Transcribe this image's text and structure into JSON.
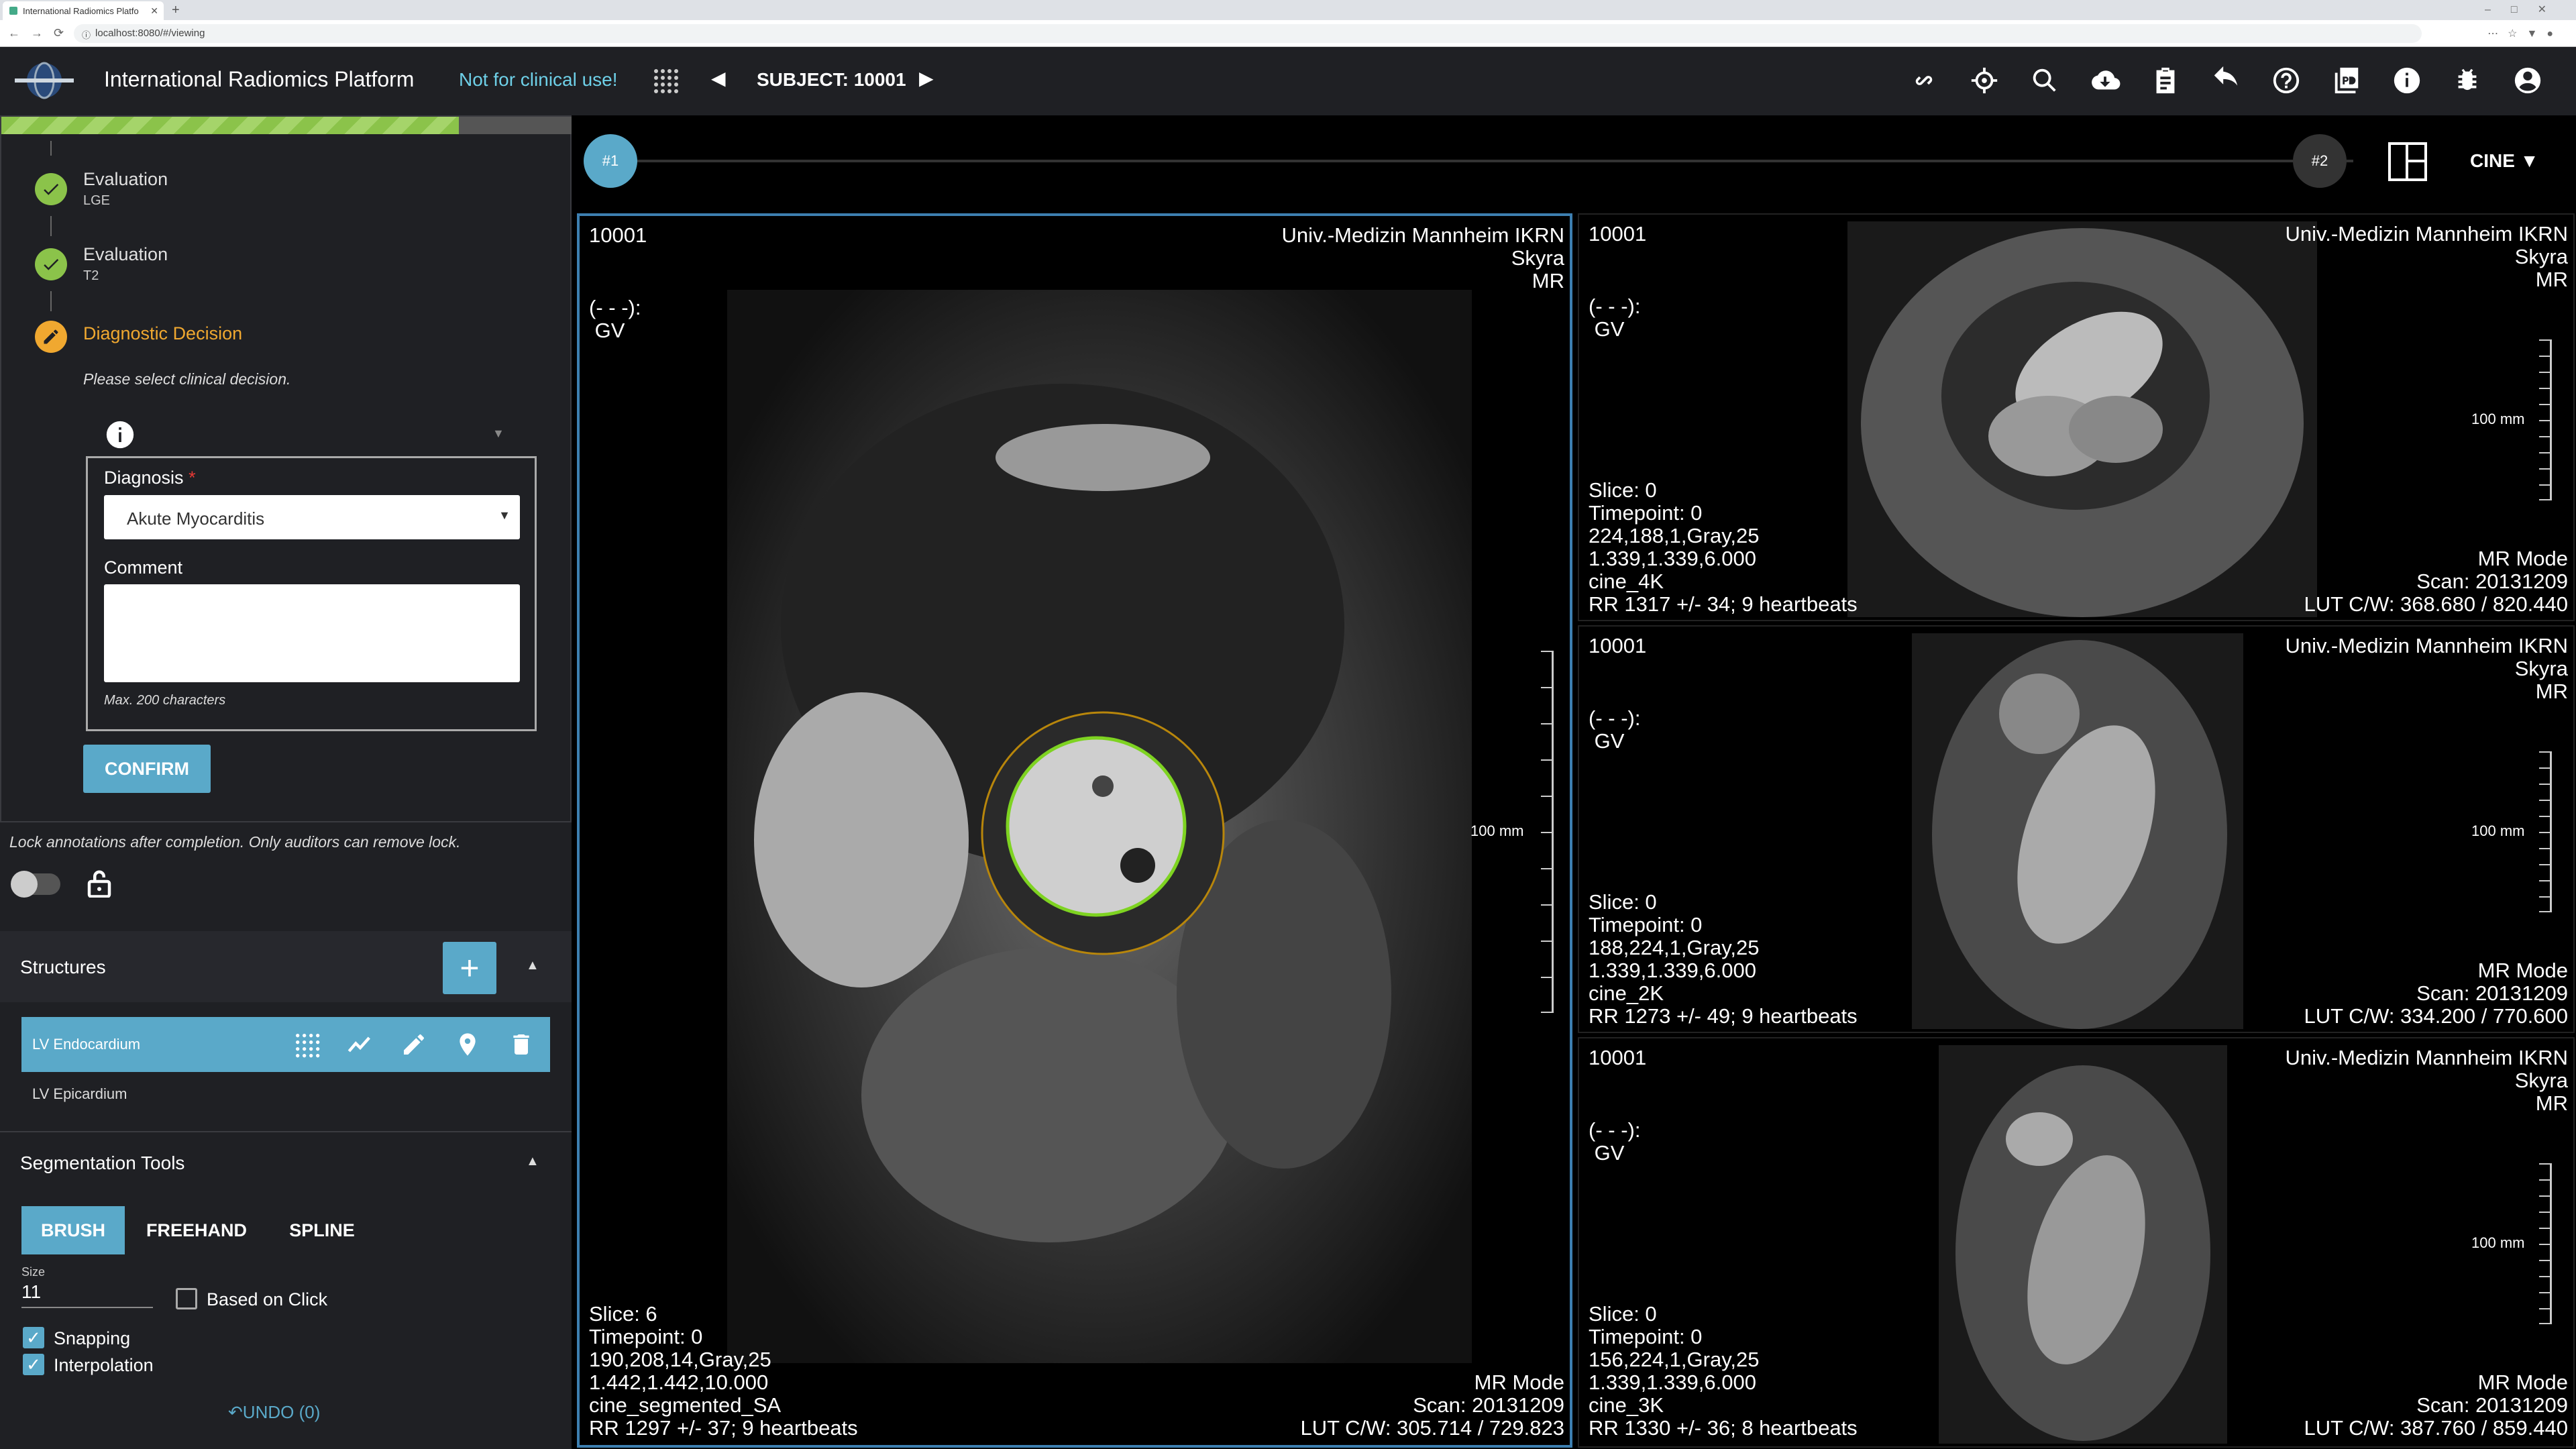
{
  "browser": {
    "tab_title": "International Radiomics Platfo",
    "url": "localhost:8080/#/viewing"
  },
  "header": {
    "title": "International Radiomics Platform",
    "warning": "Not for clinical use!",
    "subject": "SUBJECT: 10001",
    "icons": [
      "link-icon",
      "crosshair-icon",
      "zoom-icon",
      "cloud-download-icon",
      "clipboard-icon",
      "undo-icon",
      "help-icon",
      "pdf-icon",
      "info-icon",
      "bug-icon",
      "account-icon"
    ]
  },
  "workflow": {
    "progress_percent": 80,
    "steps": [
      {
        "title": "Evaluation",
        "sub": "LGE",
        "status": "done"
      },
      {
        "title": "Evaluation",
        "sub": "T2",
        "status": "done"
      },
      {
        "title": "Diagnostic Decision",
        "sub": "",
        "status": "active"
      }
    ],
    "instruction": "Please select clinical decision.",
    "diagnosis_label": "Diagnosis",
    "required_mark": "*",
    "diagnosis_value": "Akute Myocarditis",
    "comment_label": "Comment",
    "comment_value": "",
    "max_chars": "Max. 200 characters",
    "confirm_label": "CONFIRM",
    "lock_note": "Lock annotations after completion. Only auditors can remove lock."
  },
  "structures": {
    "title": "Structures",
    "add_label": "+",
    "items": [
      {
        "name": "LV Endocardium",
        "active": true
      },
      {
        "name": "LV Epicardium",
        "active": false
      }
    ]
  },
  "segmentation": {
    "title": "Segmentation Tools",
    "tabs": [
      "BRUSH",
      "FREEHAND",
      "SPLINE"
    ],
    "active_tab": "BRUSH",
    "size_label": "Size",
    "size_value": "11",
    "based_on_click": "Based on Click",
    "snapping": "Snapping",
    "interpolation": "Interpolation",
    "undo": "UNDO (0)"
  },
  "viewer": {
    "timeline_start": "#1",
    "timeline_end": "#2",
    "series": "CINE",
    "viewports": [
      {
        "id": "10001",
        "institution": "Univ.-Medizin Mannheim IKRN\nSkyra\nMR",
        "window": "(- - -):\n GV",
        "info": "Slice: 6\nTimepoint: 0\n190,208,14,Gray,25\n1.442,1.442,10.000\ncine_segmented_SA\nRR 1297 +/- 37; 9 heartbeats",
        "mode": "MR Mode\nScan: 20131209\nLUT C/W: 305.714 / 729.823",
        "scale": "100 mm"
      },
      {
        "id": "10001",
        "institution": "Univ.-Medizin Mannheim IKRN\nSkyra\nMR",
        "window": "(- - -):\n GV",
        "info": "Slice: 0\nTimepoint: 0\n224,188,1,Gray,25\n1.339,1.339,6.000\ncine_4K\nRR 1317 +/- 34; 9 heartbeats",
        "mode": "MR Mode\nScan: 20131209\nLUT C/W: 368.680 / 820.440",
        "scale": "100 mm"
      },
      {
        "id": "10001",
        "institution": "Univ.-Medizin Mannheim IKRN\nSkyra\nMR",
        "window": "(- - -):\n GV",
        "info": "Slice: 0\nTimepoint: 0\n188,224,1,Gray,25\n1.339,1.339,6.000\ncine_2K\nRR 1273 +/- 49; 9 heartbeats",
        "mode": "MR Mode\nScan: 20131209\nLUT C/W: 334.200 / 770.600",
        "scale": "100 mm"
      },
      {
        "id": "10001",
        "institution": "Univ.-Medizin Mannheim IKRN\nSkyra\nMR",
        "window": "(- - -):\n GV",
        "info": "Slice: 0\nTimepoint: 0\n156,224,1,Gray,25\n1.339,1.339,6.000\ncine_3K\nRR 1330 +/- 36; 8 heartbeats",
        "mode": "MR Mode\nScan: 20131209\nLUT C/W: 387.760 / 859.440",
        "scale": "100 mm"
      }
    ]
  },
  "colors": {
    "accent": "#5aa9c9",
    "done": "#8bc34a",
    "active_step": "#f0a830",
    "warning_text": "#6ed0e8",
    "endo_contour": "#7ed321",
    "epi_contour": "#b8860b"
  }
}
